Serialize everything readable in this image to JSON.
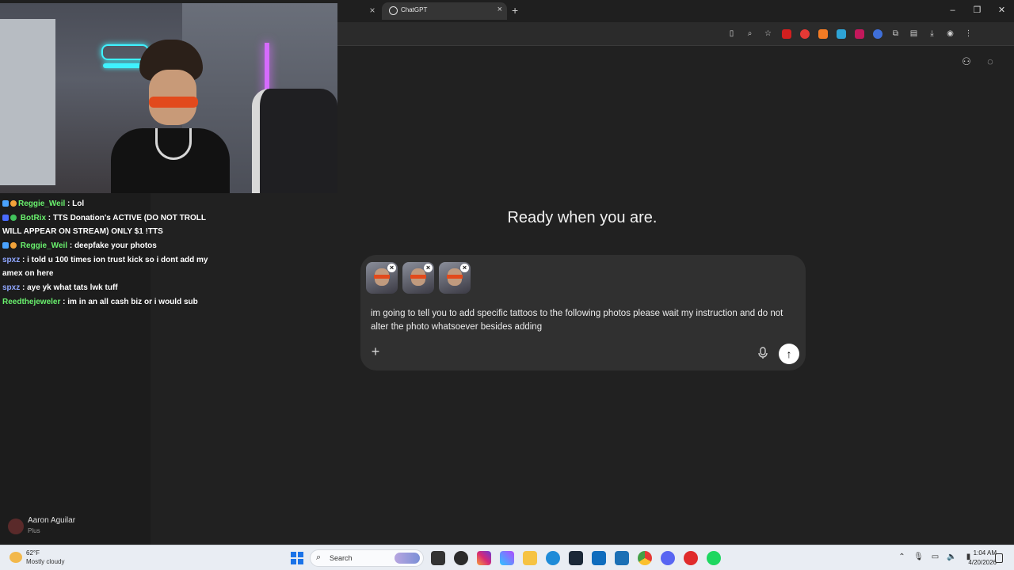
{
  "browser": {
    "tab_title": "ChatGPT",
    "tab_close": "×",
    "new_tab": "+",
    "window": {
      "minimize": "–",
      "restore": "❐",
      "close": "✕"
    }
  },
  "chat": {
    "messages": [
      {
        "user": "Reggie_Weil",
        "text": " : Lol",
        "user_color": "#69f06d"
      },
      {
        "user": "BotRix",
        "text": " : TTS Donation's ACTIVE (DO NOT TROLL WILL APPEAR ON STREAM) ONLY $1 !TTS",
        "user_color": "#69f06d"
      },
      {
        "user": "Reggie_Weil",
        "text": " : deepfake your photos",
        "user_color": "#69f06d"
      },
      {
        "user": "spxz",
        "text": " : i told u 100 times ion trust kick so i dont add my amex on here",
        "user_color": "#8fa6ff"
      },
      {
        "user": "spxz",
        "text": " : aye yk what tats lwk tuff",
        "user_color": "#8fa6ff"
      },
      {
        "user": "Reedthejeweler",
        "text": " : im in an all cash biz or i would sub",
        "user_color": "#69f06d"
      }
    ]
  },
  "sidebar": {
    "profile_name": "Aaron Aguilar",
    "profile_plan": "Plus"
  },
  "main": {
    "heading": "Ready when you are.",
    "attachments": [
      "photo-1",
      "photo-2",
      "photo-3"
    ],
    "remove_label": "×",
    "prompt_text": "im going to tell you to add specific tattoos to the following photos please wait my instruction and do not alter the photo whatsoever besides adding",
    "plus_label": "+",
    "send_label": "↑"
  },
  "taskbar": {
    "temp": "62°F",
    "weather": "Mostly cloudy",
    "search_placeholder": "Search",
    "time": "1:04 AM",
    "date": "4/20/2026"
  },
  "colors": {
    "accent_green": "#69f06d",
    "accent_blue": "#8fa6ff",
    "background": "#212121",
    "composer": "#303030"
  }
}
